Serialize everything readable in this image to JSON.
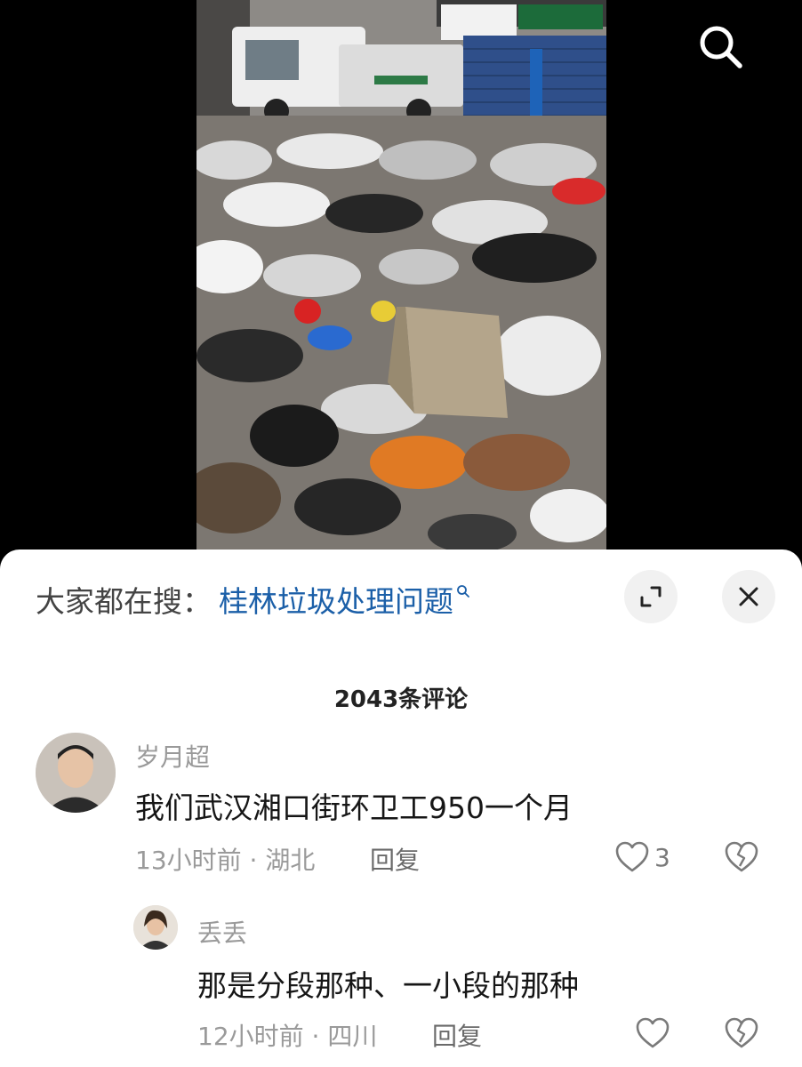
{
  "search": {
    "icon": "search-icon"
  },
  "sheet": {
    "hot_search_prefix": "大家都在搜：",
    "hot_search_term": "桂林垃圾处理问题",
    "expand_icon": "expand-icon",
    "close_icon": "close-icon"
  },
  "comments_header": "2043条评论",
  "comments": [
    {
      "user": "岁月超",
      "text": "我们武汉湘口街环卫工950一个月",
      "meta": "13小时前 · 湖北",
      "reply_label": "回复",
      "likes": "3"
    },
    {
      "user": "丢丢",
      "text": "那是分段那种、一小段的那种",
      "meta": "12小时前 · 四川",
      "reply_label": "回复",
      "likes": ""
    }
  ],
  "colors": {
    "link": "#1b5fa8",
    "secondary_text": "#9a9a9a",
    "sheet_bg": "#ffffff",
    "video_bg": "#000000"
  }
}
